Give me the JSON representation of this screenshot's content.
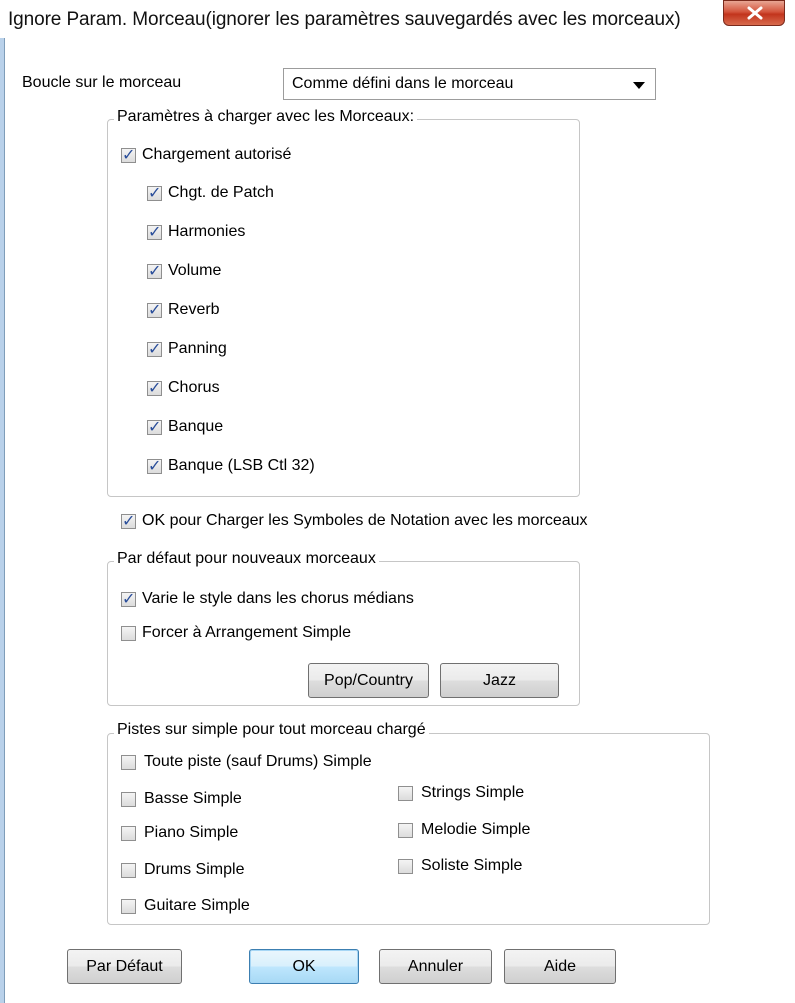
{
  "window": {
    "title": "Ignore Param. Morceau(ignorer les paramètres sauvegardés avec les morceaux)"
  },
  "loop": {
    "label": "Boucle sur le morceau",
    "value": "Comme défini dans le morceau"
  },
  "params_group": {
    "title": "Paramètres à charger avec les Morceaux:",
    "allow_label": "Chargement autorisé",
    "items": [
      {
        "label": "Chgt. de Patch",
        "checked": true
      },
      {
        "label": "Harmonies",
        "checked": true
      },
      {
        "label": "Volume",
        "checked": true
      },
      {
        "label": "Reverb",
        "checked": true
      },
      {
        "label": "Panning",
        "checked": true
      },
      {
        "label": "Chorus",
        "checked": true
      },
      {
        "label": "Banque",
        "checked": true
      },
      {
        "label": "Banque (LSB Ctl 32)",
        "checked": true
      }
    ]
  },
  "notation": {
    "label": "OK pour Charger les Symboles de Notation avec les morceaux",
    "checked": true
  },
  "defaults_group": {
    "title": "Par défaut pour nouveaux morceaux",
    "vary_label": "Varie le style dans les chorus médians",
    "force_label": "Forcer à Arrangement Simple",
    "pop_button": "Pop/Country",
    "jazz_button": "Jazz"
  },
  "simple_group": {
    "title": "Pistes sur simple pour tout morceau chargé",
    "all_tracks": "Toute piste (sauf Drums) Simple",
    "bass": "Basse Simple",
    "piano": "Piano Simple",
    "drums": "Drums Simple",
    "guitar": "Guitare Simple",
    "strings": "Strings Simple",
    "melody": "Melodie Simple",
    "soloist": "Soliste Simple"
  },
  "buttons": {
    "default": "Par Défaut",
    "ok": "OK",
    "cancel": "Annuler",
    "help": "Aide"
  },
  "colors": {
    "accent": "#3c7fb1",
    "close": "#c2341d",
    "check": "#2a4e9a"
  }
}
